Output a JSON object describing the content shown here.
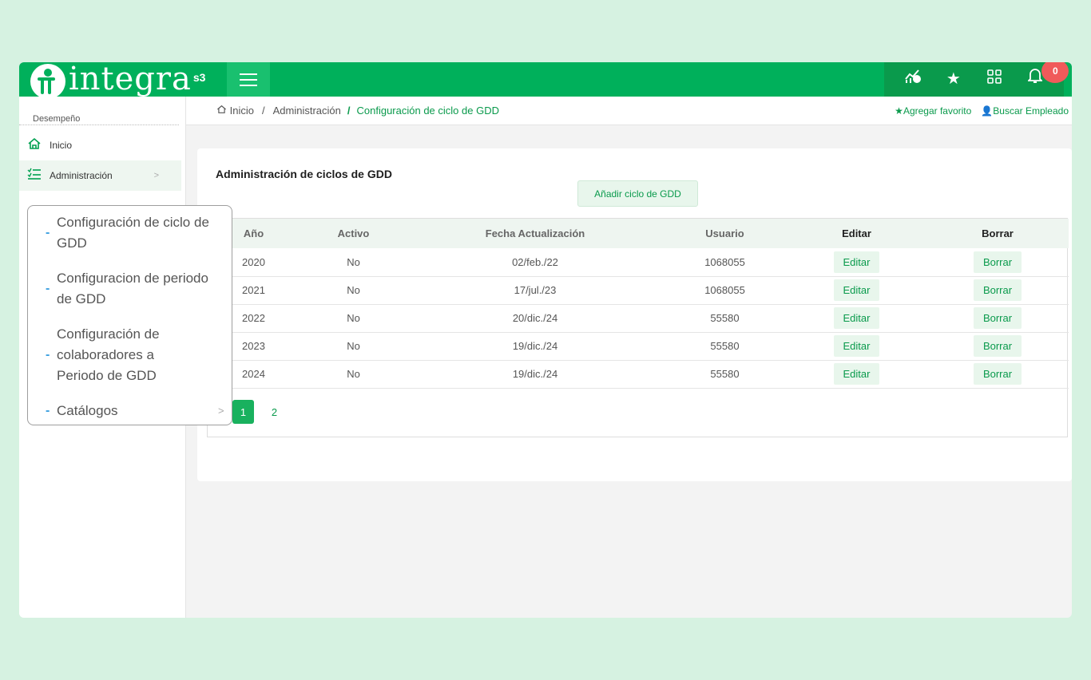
{
  "topbar": {
    "logo_text": "integra",
    "logo_sup": "s3",
    "notifications_count": "0"
  },
  "sidebar": {
    "section": "Desempeño",
    "items": [
      {
        "label": "Inicio",
        "icon": "home-icon"
      },
      {
        "label": "Administración",
        "icon": "checklist-icon"
      }
    ],
    "submenu": [
      {
        "label": "Configuración de ciclo de GDD"
      },
      {
        "label": "Configuracion de periodo de GDD"
      },
      {
        "label": "Configuración de colaboradores a Periodo de GDD"
      },
      {
        "label": "Catálogos"
      }
    ]
  },
  "breadcrumb": {
    "home": "Inicio",
    "level1": "Administración",
    "current": "Configuración de ciclo de GDD"
  },
  "quick_links": {
    "favorite": "Agregar favorito",
    "search_employee": "Buscar Empleado"
  },
  "main": {
    "title": "Administración de ciclos de GDD",
    "add_button": "Añadir ciclo de GDD",
    "columns": [
      "Año",
      "Activo",
      "Fecha Actualización",
      "Usuario",
      "Editar",
      "Borrar"
    ],
    "rows": [
      {
        "year": "2020",
        "active": "No",
        "date": "02/feb./22",
        "user": "1068055",
        "edit": "Editar",
        "delete": "Borrar"
      },
      {
        "year": "2021",
        "active": "No",
        "date": "17/jul./23",
        "user": "1068055",
        "edit": "Editar",
        "delete": "Borrar"
      },
      {
        "year": "2022",
        "active": "No",
        "date": "20/dic./24",
        "user": "55580",
        "edit": "Editar",
        "delete": "Borrar"
      },
      {
        "year": "2023",
        "active": "No",
        "date": "19/dic./24",
        "user": "55580",
        "edit": "Editar",
        "delete": "Borrar"
      },
      {
        "year": "2024",
        "active": "No",
        "date": "19/dic./24",
        "user": "55580",
        "edit": "Editar",
        "delete": "Borrar"
      }
    ],
    "pages": [
      "1",
      "2"
    ],
    "current_page": "1"
  }
}
